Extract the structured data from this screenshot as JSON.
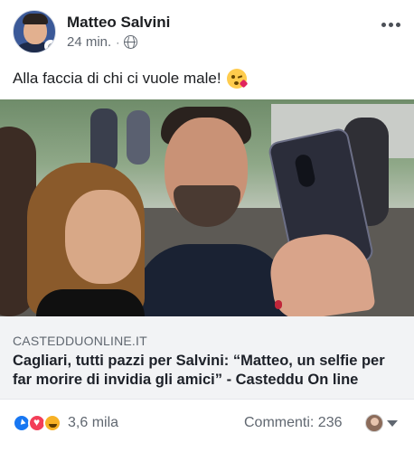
{
  "post": {
    "author": "Matteo Salvini",
    "time": "24 min.",
    "separator": "·",
    "privacy_icon": "globe-icon",
    "menu_icon": "more-horizontal-icon",
    "text": "Alla faccia di chi ci vuole male!",
    "emoji": "kissing-heart-emoji"
  },
  "link_preview": {
    "domain": "CASTEDDUONLINE.IT",
    "title": "Cagliari, tutti pazzi per Salvini: “Matteo, un selfie per far morire di invidia gli amici” - Casteddu On line"
  },
  "footer": {
    "reaction_icons": [
      "like-icon",
      "love-icon",
      "haha-icon"
    ],
    "reactions_count": "3,6 mila",
    "comments_label": "Commenti: 236"
  },
  "colors": {
    "text": "#1c1e21",
    "secondary_text": "#606770",
    "link_box_bg": "#f2f3f5",
    "like_blue": "#1877f2",
    "love_red": "#f33e58",
    "haha_yellow": "#f7b125"
  }
}
